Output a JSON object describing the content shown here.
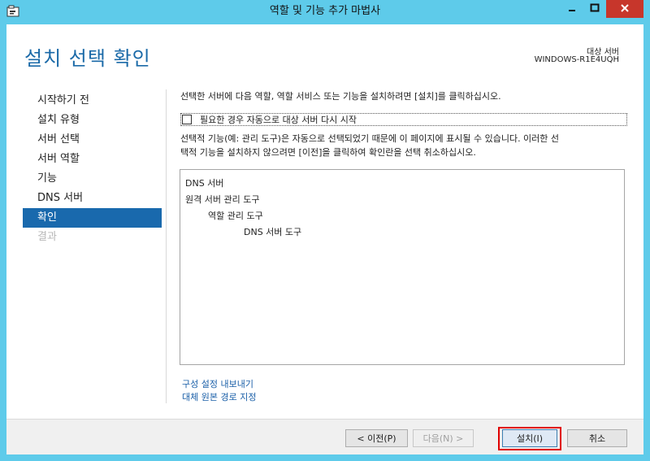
{
  "window": {
    "title": "역할 및 기능 추가 마법사",
    "colors": {
      "frame": "#5ecbea",
      "close": "#c7362b",
      "accent": "#1969ad",
      "title_text": "#1b6aa8",
      "highlight": "#e00000"
    }
  },
  "header": {
    "page_title": "설치 선택 확인",
    "target_label": "대상 서버",
    "target_name": "WINDOWS-R1E4UQH"
  },
  "nav": {
    "items": [
      {
        "label": "시작하기 전",
        "state": "normal"
      },
      {
        "label": "설치 유형",
        "state": "normal"
      },
      {
        "label": "서버 선택",
        "state": "normal"
      },
      {
        "label": "서버 역할",
        "state": "normal"
      },
      {
        "label": "기능",
        "state": "normal"
      },
      {
        "label": "DNS 서버",
        "state": "normal"
      },
      {
        "label": "확인",
        "state": "active"
      },
      {
        "label": "결과",
        "state": "disabled"
      }
    ]
  },
  "main": {
    "intro": "선택한 서버에 다음 역할, 역할 서비스 또는 기능을 설치하려면 [설치]를 클릭하십시오.",
    "restart_checkbox": {
      "label": "필요한 경우 자동으로 대상 서버 다시 시작",
      "checked": false
    },
    "notice_line1": "선택적 기능(예: 관리 도구)은 자동으로 선택되었기 때문에 이 페이지에 표시될 수 있습니다. 이러한 선",
    "notice_line2": "택적 기능을 설치하지 않으려면 [이전]을 클릭하여 확인란을 선택 취소하십시오.",
    "selection_list": [
      "DNS 서버",
      "원격 서버 관리 도구",
      "역할 관리 도구",
      "DNS 서버 도구"
    ],
    "links": {
      "export": "구성 설정 내보내기",
      "alt_source": "대체 원본 경로 지정"
    }
  },
  "footer": {
    "prev_label": "< 이전(P)",
    "next_label": "다음(N) >",
    "install_label": "설치(I)",
    "cancel_label": "취소"
  },
  "icons": {
    "app": "server-manager-icon",
    "minimize": "minimize-icon",
    "maximize": "maximize-icon",
    "close": "close-icon"
  }
}
